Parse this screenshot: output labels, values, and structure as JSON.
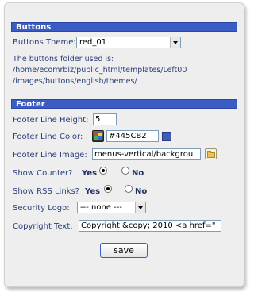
{
  "buttons_section": {
    "header": "Buttons",
    "theme_label": "Buttons Theme:",
    "theme_value": "red_01",
    "folder_info": [
      "The buttons folder used is:",
      "/home/ecomrbiz/public_html/templates/Left00",
      "/images/buttons/english/themes/"
    ]
  },
  "footer_section": {
    "header": "Footer",
    "line_height_label": "Footer Line Height:",
    "line_height_value": "5",
    "line_color_label": "Footer Line Color:",
    "line_color_value": "#445CB2",
    "line_image_label": "Footer Line Image:",
    "line_image_value": "menus-vertical/backgrou",
    "show_counter_label": "Show Counter?",
    "show_counter_yes": "Yes",
    "show_counter_no": "No",
    "show_counter_selected": "Yes",
    "show_rss_label": "Show RSS Links?",
    "show_rss_yes": "Yes",
    "show_rss_no": "No",
    "show_rss_selected": "Yes",
    "security_logo_label": "Security Logo:",
    "security_logo_value": "--- none ---",
    "copyright_label": "Copyright Text:",
    "copyright_value": "Copyright &copy; 2010 <a href=\""
  },
  "actions": {
    "save_label": "save"
  },
  "colors": {
    "header_bg": "#3b5cc4",
    "label_text": "#2a3f78",
    "line_color": "#445CB2"
  },
  "icons": {
    "color_picker": "color-picker-icon",
    "folder": "folder-browse-icon"
  }
}
